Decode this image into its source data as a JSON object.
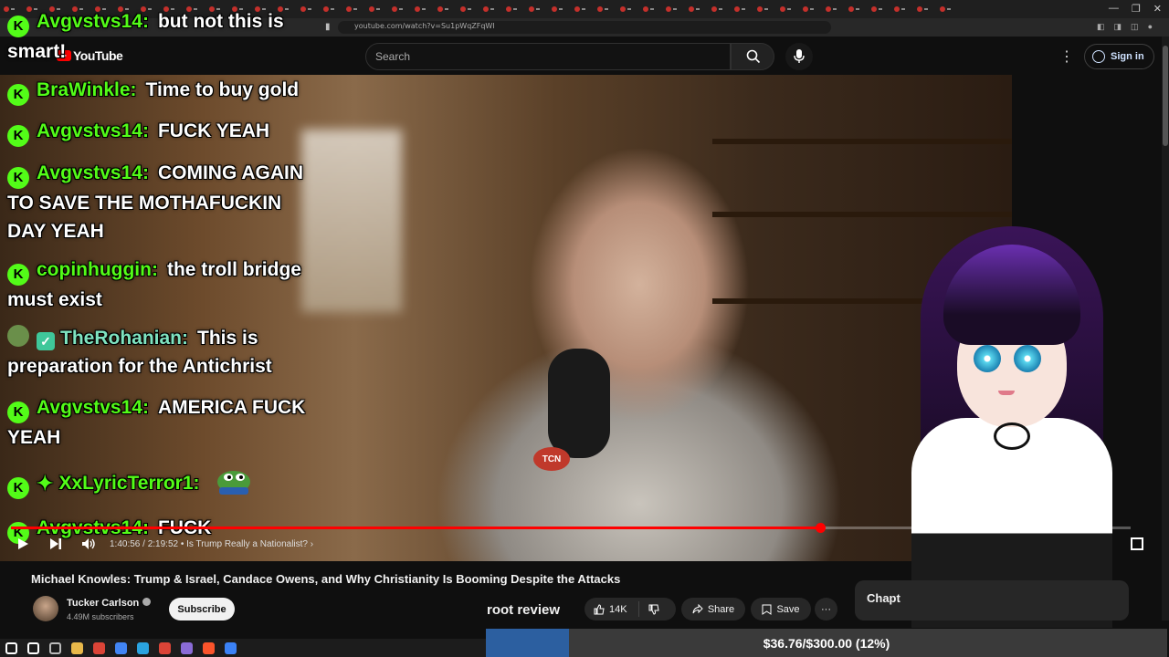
{
  "browser": {
    "tab_count": 42,
    "url": "youtube.com/watch?v=Su1pWqZFqWI",
    "window_controls": [
      "—",
      "❐",
      "✕"
    ]
  },
  "header": {
    "logo_text": "YouTube",
    "search_placeholder": "Search",
    "signin_label": "Sign in",
    "icons": [
      "search-icon",
      "mic-icon",
      "kebab-menu-icon",
      "account-icon"
    ]
  },
  "chat": {
    "messages": [
      {
        "user": "Avgvstvs14:",
        "text": "but not this is smart!",
        "badge": "K"
      },
      {
        "user": "BraWinkle:",
        "text": "Time to buy gold",
        "badge": "K"
      },
      {
        "user": "Avgvstvs14:",
        "text": "FUCK YEAH",
        "badge": "K"
      },
      {
        "user": "Avgvstvs14:",
        "text": "COMING AGAIN TO SAVE THE MOTHAFUCKIN DAY YEAH",
        "badge": "K"
      },
      {
        "user": "copinhuggin:",
        "text": "the troll bridge must exist",
        "badge": "K"
      },
      {
        "user": "TheRohanian:",
        "text": "This is preparation for the Antichrist",
        "badge": "frog"
      },
      {
        "user": "Avgvstvs14:",
        "text": "AMERICA FUCK YEAH",
        "badge": "K"
      },
      {
        "user": "XxLyricTerror1:",
        "text": "",
        "badge": "K"
      },
      {
        "user": "Avgvstvs14:",
        "text": "FUCK",
        "badge": "K"
      }
    ]
  },
  "player": {
    "time": "1:40:56 / 2:19:52",
    "chapter": "Is Trump Really a Nationalist?",
    "chevron": "›",
    "progress": 0.7225,
    "icons": [
      "play-icon",
      "next-icon",
      "volume-icon",
      "fullscreen-icon"
    ]
  },
  "video": {
    "title": "Michael Knowles: Trump & Israel, Candace Owens, and Why Christianity Is Booming Despite the Attacks",
    "channel": "Tucker Carlson",
    "subscribers": "4.49M subscribers",
    "subscribe_label": "Subscribe",
    "likes": "14K",
    "share_label": "Share",
    "save_label": "Save",
    "more_label": "···",
    "chapters_label": "Chapt",
    "mic_badge": "TCN"
  },
  "overlay": {
    "text": "root review"
  },
  "goal": {
    "text": "$36.76/$300.00 (12%)",
    "progress": 0.1225,
    "color": "#2c5fa0"
  },
  "taskbar": {
    "icons": [
      "windows-icon",
      "search-icon",
      "task-view-icon",
      "file-explorer-icon",
      "chrome-icon",
      "browser-icon",
      "telegram-icon",
      "chrome-icon",
      "obs-icon",
      "brave-icon",
      "app-icon"
    ]
  },
  "colors": {
    "kick_green": "#53fc18",
    "yt_red": "#ff0000",
    "background": "#0f0f0f"
  }
}
